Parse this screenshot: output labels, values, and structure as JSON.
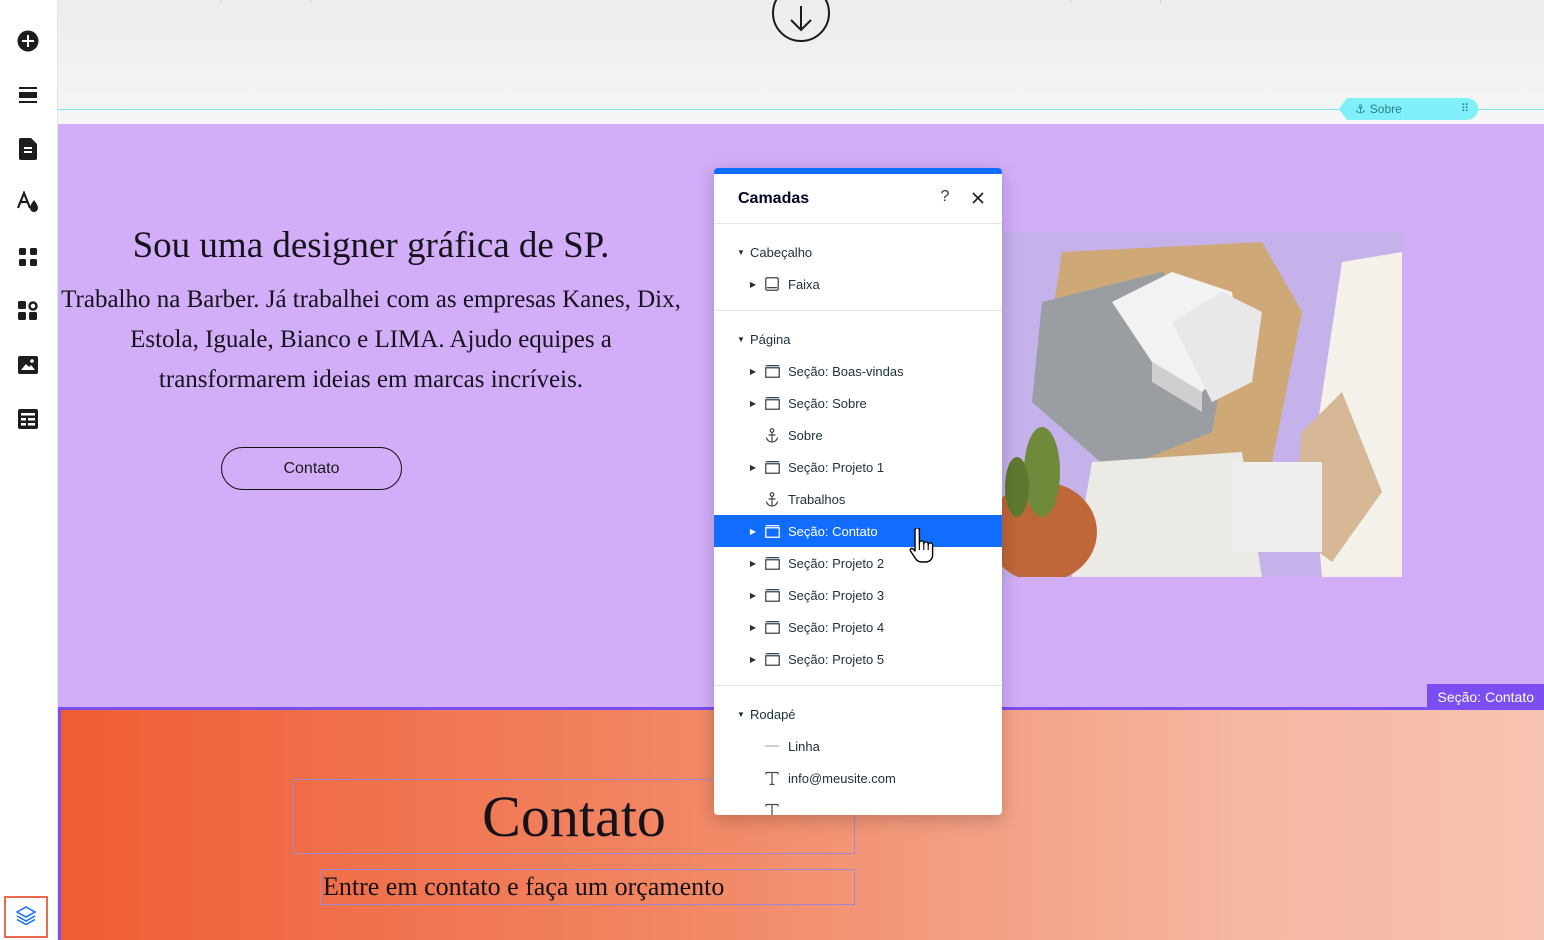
{
  "toolbar": {
    "tools": [
      {
        "name": "add-elements"
      },
      {
        "name": "add-section"
      },
      {
        "name": "pages-menu"
      },
      {
        "name": "site-design"
      },
      {
        "name": "add-apps"
      },
      {
        "name": "business-tools"
      },
      {
        "name": "media"
      },
      {
        "name": "cms"
      }
    ],
    "layers_button": "layers"
  },
  "canvas": {
    "anchor_tag": "Sobre",
    "hero": {
      "title": "Sou uma designer gráfica de SP.",
      "body": "Trabalho na Barber. Já trabalhei com as empresas Kanes, Dix, Estola, Iguale, Bianco e LIMA. Ajudo equipes a transformarem ideias em marcas incríveis.",
      "button": "Contato"
    },
    "contact": {
      "section_tag": "Seção: Contato",
      "title": "Contato",
      "subtitle": "Entre em contato e faça um orçamento"
    }
  },
  "layers_panel": {
    "title": "Camadas",
    "help": "?",
    "groups": [
      {
        "label": "Cabeçalho",
        "items": [
          {
            "label": "Faixa",
            "icon": "strip-icon",
            "expandable": true
          }
        ]
      },
      {
        "label": "Página",
        "items": [
          {
            "label": "Seção: Boas-vindas",
            "icon": "section-icon",
            "expandable": true
          },
          {
            "label": "Seção: Sobre",
            "icon": "section-icon",
            "expandable": true
          },
          {
            "label": "Sobre",
            "icon": "anchor-icon",
            "expandable": false
          },
          {
            "label": "Seção: Projeto 1",
            "icon": "section-icon",
            "expandable": true
          },
          {
            "label": "Trabalhos",
            "icon": "anchor-icon",
            "expandable": false
          },
          {
            "label": "Seção: Contato",
            "icon": "section-icon",
            "expandable": true,
            "selected": true
          },
          {
            "label": "Seção: Projeto 2",
            "icon": "section-icon",
            "expandable": true
          },
          {
            "label": "Seção: Projeto 3",
            "icon": "section-icon",
            "expandable": true
          },
          {
            "label": "Seção: Projeto 4",
            "icon": "section-icon",
            "expandable": true
          },
          {
            "label": "Seção: Projeto 5",
            "icon": "section-icon",
            "expandable": true
          }
        ]
      },
      {
        "label": "Rodapé",
        "items": [
          {
            "label": "Linha",
            "icon": "line-icon",
            "expandable": false
          },
          {
            "label": "info@meusite.com",
            "icon": "text-icon",
            "expandable": false
          },
          {
            "label": "",
            "icon": "text-icon",
            "expandable": false
          }
        ]
      }
    ]
  },
  "colors": {
    "accent": "#116dff",
    "selection_purple": "#7b4ef2",
    "hero_bg": "#d2aef8",
    "contact_gradient_start": "#ef5c34",
    "contact_gradient_end": "#f7c3b2",
    "anchor_cyan": "#7ff0f8",
    "layers_highlight": "#ea6a4f"
  }
}
